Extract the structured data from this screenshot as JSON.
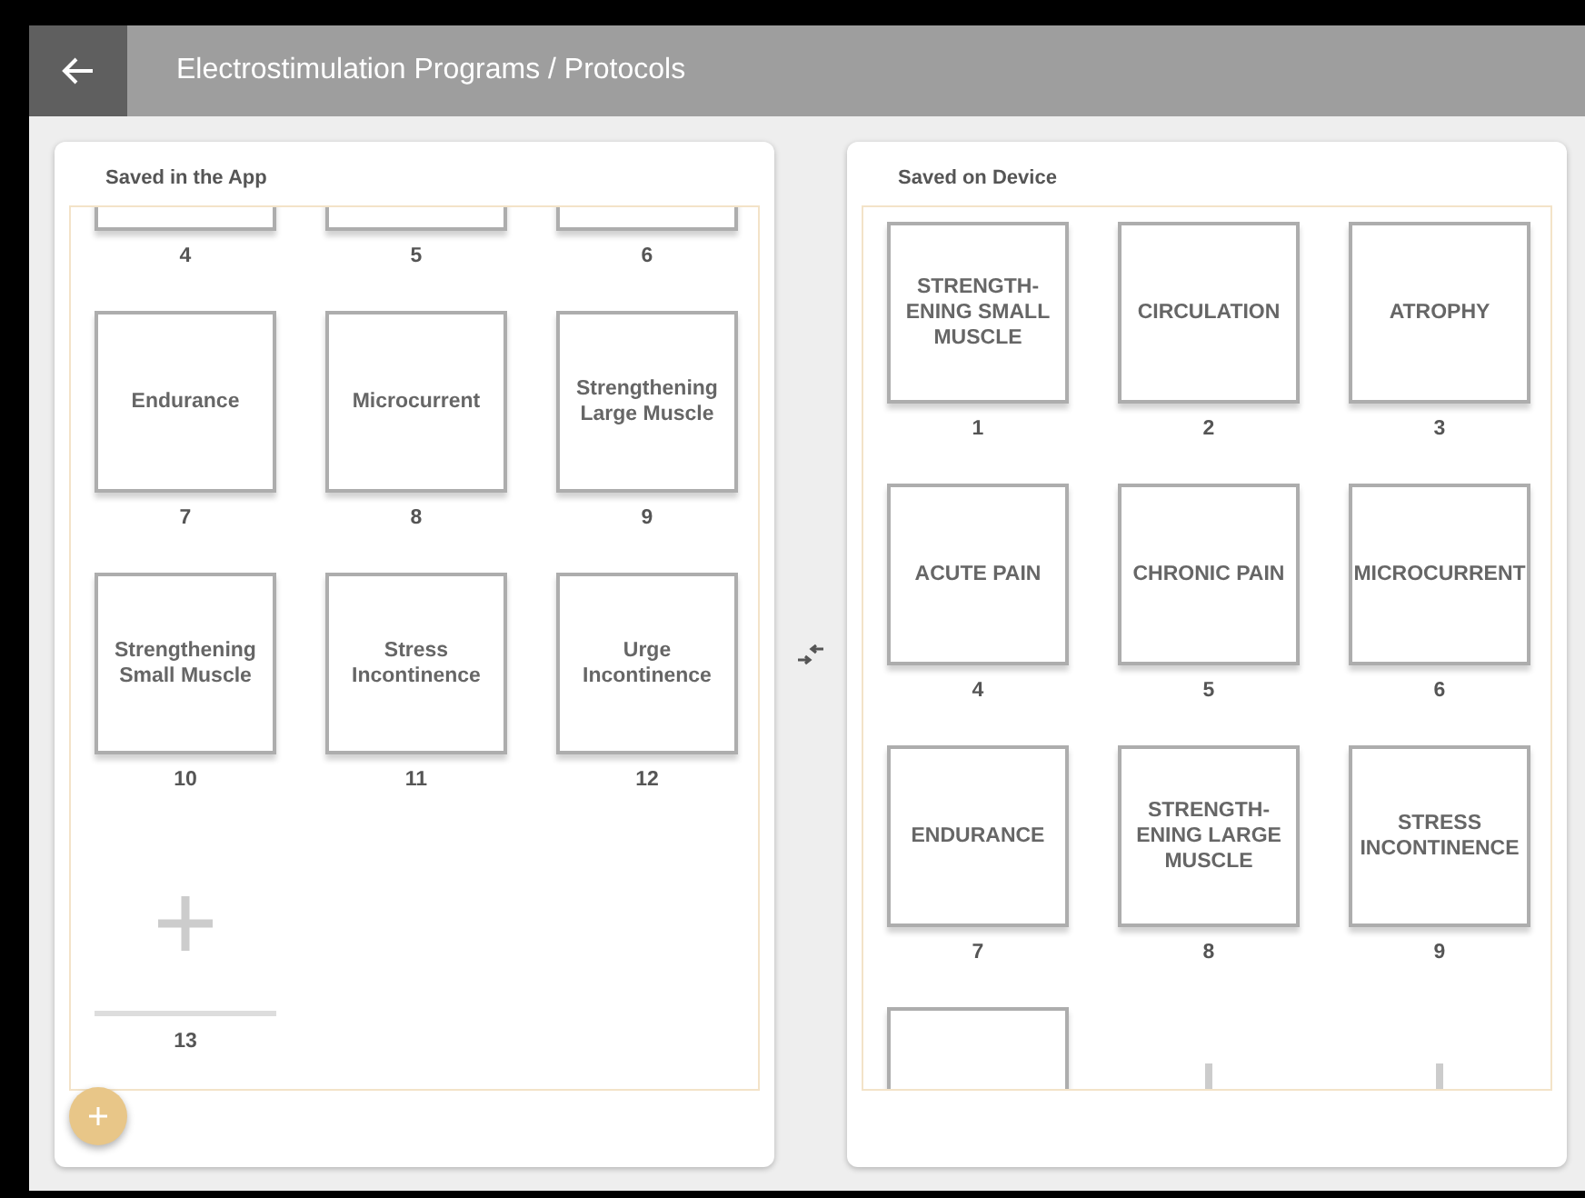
{
  "app_bar": {
    "title": "Electrostimulation Programs / Protocols"
  },
  "panels": [
    {
      "title": "Saved in the App",
      "has_add_button": true,
      "tiles": [
        {
          "kind": "program",
          "number": "4"
        },
        {
          "kind": "program",
          "number": "5"
        },
        {
          "kind": "program",
          "number": "6"
        },
        {
          "kind": "program",
          "label": "Endurance",
          "number": "7"
        },
        {
          "kind": "program",
          "label": "Microcurrent",
          "number": "8"
        },
        {
          "kind": "program",
          "label": "Strengthening Large Muscle",
          "number": "9"
        },
        {
          "kind": "program",
          "label": "Strengthening Small Muscle",
          "number": "10"
        },
        {
          "kind": "program",
          "label": "Stress Incontinence",
          "number": "11"
        },
        {
          "kind": "program",
          "label": "Urge Incontinence",
          "number": "12"
        },
        {
          "kind": "add",
          "number": "13"
        }
      ]
    },
    {
      "title": "Saved on Device",
      "has_add_button": false,
      "tiles": [
        {
          "kind": "program",
          "label": "STRENGTH-ENING SMALL MUSCLE",
          "number": "1"
        },
        {
          "kind": "program",
          "label": "CIRCULATION",
          "number": "2"
        },
        {
          "kind": "program",
          "label": "ATROPHY",
          "number": "3"
        },
        {
          "kind": "program",
          "label": "ACUTE PAIN",
          "number": "4"
        },
        {
          "kind": "program",
          "label": "CHRONIC PAIN",
          "number": "5"
        },
        {
          "kind": "program",
          "label": "MICROCURRENT",
          "number": "6"
        },
        {
          "kind": "program",
          "label": "ENDURANCE",
          "number": "7"
        },
        {
          "kind": "program",
          "label": "STRENGTH-ENING LARGE MUSCLE",
          "number": "8"
        },
        {
          "kind": "program",
          "label": "STRESS INCONTINENCE",
          "number": "9"
        },
        {
          "kind": "program"
        },
        {
          "kind": "add"
        },
        {
          "kind": "add"
        }
      ]
    }
  ]
}
